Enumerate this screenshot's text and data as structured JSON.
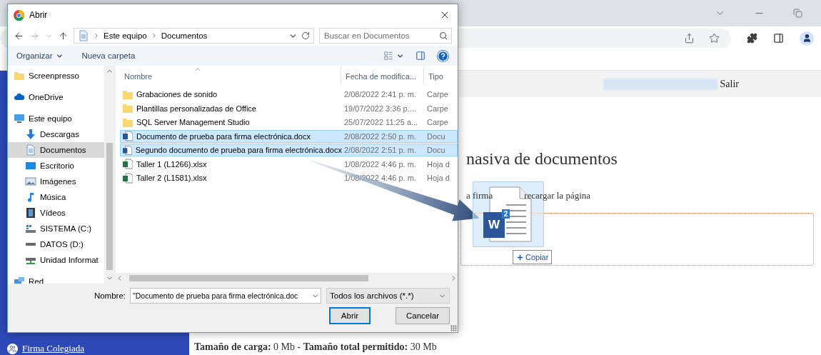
{
  "page": {
    "header": {
      "logout": "Salir"
    },
    "heading": "nasiva de documentos",
    "instructions": [
      "a firma",
      "recargar la página"
    ],
    "upload_summary": "**Tamaño de carga:** 0 Mb - **Tamaño total permitido:** 30 Mb",
    "sidebar": {
      "items": [
        {
          "label": "Firma Colegiada"
        }
      ]
    }
  },
  "dialog": {
    "title": "Abrir",
    "path": [
      "Este equipo",
      "Documentos"
    ],
    "search": {
      "placeholder": "Buscar en Documentos"
    },
    "commands": {
      "organize": "Organizar",
      "new_folder": "Nueva carpeta"
    },
    "nav": [
      {
        "label": "Screenpresso",
        "kind": "folder",
        "selected": false
      },
      {
        "label": "OneDrive",
        "kind": "cloud",
        "selected": false
      },
      {
        "label": "Este equipo",
        "kind": "computer",
        "selected": false,
        "children": [
          {
            "label": "Descargas",
            "kind": "download",
            "selected": false
          },
          {
            "label": "Documentos",
            "kind": "documents",
            "selected": true
          },
          {
            "label": "Escritorio",
            "kind": "desktop",
            "selected": false
          },
          {
            "label": "Imágenes",
            "kind": "pictures",
            "selected": false
          },
          {
            "label": "Música",
            "kind": "music",
            "selected": false
          },
          {
            "label": "Vídeos",
            "kind": "videos",
            "selected": false
          },
          {
            "label": "SISTEMA (C:)",
            "kind": "system_drive",
            "selected": false
          },
          {
            "label": "DATOS (D:)",
            "kind": "drive",
            "selected": false
          },
          {
            "label": "Unidad Informat",
            "kind": "network_drive",
            "selected": false
          }
        ]
      },
      {
        "label": "Red",
        "kind": "network",
        "selected": false
      }
    ],
    "columns": [
      "Nombre",
      "Fecha de modifica...",
      "Tipo"
    ],
    "rows": [
      {
        "name": "Grabaciones de sonido",
        "date": "2/08/2022 2:41 p. m.",
        "type": "Carpe",
        "kind": "folder",
        "selected": false
      },
      {
        "name": "Plantillas personalizadas de Office",
        "date": "19/07/2022 3:36 p....",
        "type": "Carpe",
        "kind": "folder",
        "selected": false
      },
      {
        "name": "SQL Server Management Studio",
        "date": "25/07/2022 11:25 a...",
        "type": "Carpe",
        "kind": "folder",
        "selected": false
      },
      {
        "name": "Documento de prueba para firma electrónica.docx",
        "date": "2/08/2022 2:50 p. m.",
        "type": "Docu",
        "kind": "word",
        "selected": true
      },
      {
        "name": "Segundo documento de prueba para firma electrónica.docx",
        "date": "2/08/2022 2:51 p. m.",
        "type": "Docu",
        "kind": "word",
        "selected": true
      },
      {
        "name": "Taller 1 (L1266).xlsx",
        "date": "1/08/2022 4:46 p. m.",
        "type": "Hoja d",
        "kind": "excel",
        "selected": false
      },
      {
        "name": "Taller 2 (L1581).xlsx",
        "date": "1/08/2022 4:46 p. m.",
        "type": "Hoja d",
        "kind": "excel",
        "selected": false
      }
    ],
    "filename": {
      "label": "Nombre:",
      "value": "\"Documento de prueba para firma electrónica.doc"
    },
    "filter": "Todos los archivos (*.*)",
    "buttons": [
      {
        "label": "Abrir",
        "default": true
      },
      {
        "label": "Cancelar",
        "default": false
      }
    ]
  },
  "drag": {
    "app_letter": "W",
    "count": "2",
    "action": "Copiar"
  }
}
